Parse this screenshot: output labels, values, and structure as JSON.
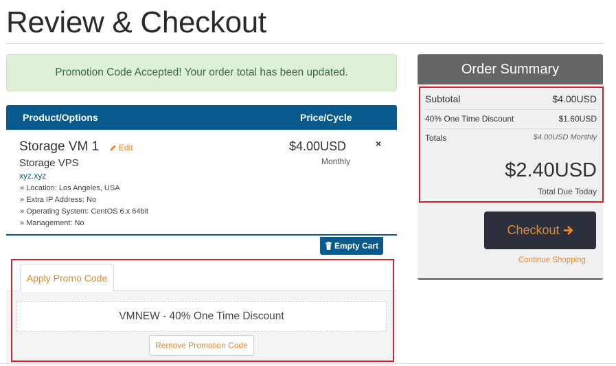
{
  "page": {
    "title": "Review & Checkout"
  },
  "alert": {
    "message": "Promotion Code Accepted! Your order total has been updated."
  },
  "cart": {
    "headers": {
      "product": "Product/Options",
      "price": "Price/Cycle"
    },
    "item": {
      "name": "Storage VM 1",
      "edit_label": "Edit",
      "group": "Storage VPS",
      "domain": "xyz.xyz",
      "options": [
        "Location: Los Angeles, USA",
        "Extra IP Address: No",
        "Operating System: CentOS 6.x 64bit",
        "Management: No"
      ],
      "price": "$4.00USD",
      "cycle": "Monthly",
      "remove_glyph": "×"
    },
    "empty_cart_label": "Empty Cart"
  },
  "promo": {
    "tab_label": "Apply Promo Code",
    "applied_code": "VMNEW - 40% One Time Discount",
    "remove_label": "Remove Promotion Code"
  },
  "summary": {
    "title": "Order Summary",
    "subtotal_label": "Subtotal",
    "subtotal_value": "$4.00USD",
    "discount_label": "40% One Time Discount",
    "discount_value": "$1.60USD",
    "totals_label": "Totals",
    "totals_value": "$4.00USD Monthly",
    "total_due": "$2.40USD",
    "total_due_label": "Total Due Today",
    "checkout_label": "Checkout",
    "continue_label": "Continue Shopping"
  },
  "colors": {
    "accent": "#e8892e",
    "primary": "#095a8c",
    "highlight_border": "#d9202a",
    "success_bg": "#dff0d8"
  },
  "icons": [
    "pencil-icon",
    "trash-icon",
    "close-icon",
    "arrow-right-icon"
  ]
}
